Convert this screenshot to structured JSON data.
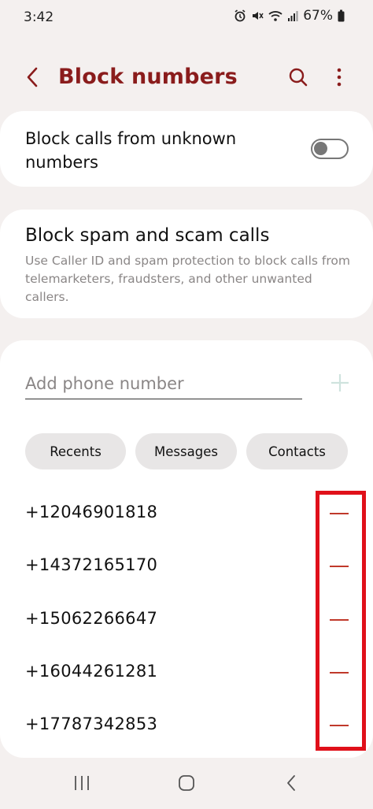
{
  "status_bar": {
    "time": "3:42",
    "battery": "67%"
  },
  "header": {
    "title": "Block numbers"
  },
  "unknown_numbers": {
    "label": "Block calls from unknown numbers",
    "enabled": false
  },
  "spam": {
    "title": "Block spam and scam calls",
    "description": "Use Caller ID and spam protection to block calls from telemarketers, fraudsters, and other unwanted callers."
  },
  "add_number": {
    "placeholder": "Add phone number"
  },
  "chips": {
    "recents": "Recents",
    "messages": "Messages",
    "contacts": "Contacts"
  },
  "blocked_numbers": [
    "+12046901818",
    "+14372165170",
    "+15062266647",
    "+16044261281",
    "+17787342853"
  ],
  "colors": {
    "accent": "#8a1c1c",
    "remove": "#c0392b",
    "highlight": "#e0101a",
    "background": "#f4f0ef"
  }
}
